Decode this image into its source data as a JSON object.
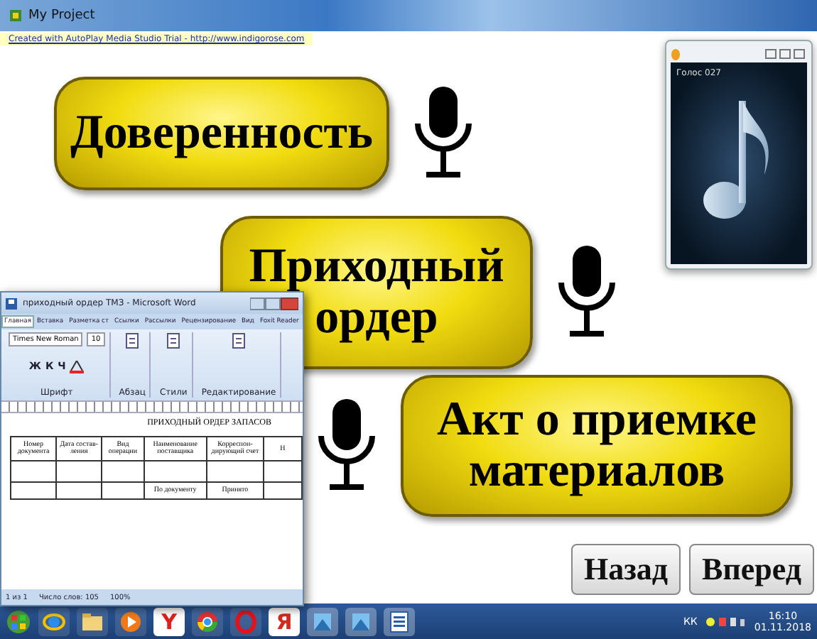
{
  "main_window": {
    "title": "My Project",
    "trial_link": "Created with AutoPlay Media Studio Trial - http://www.indigorose.com",
    "rows": [
      {
        "kind": "pill-then-mic",
        "label": "Доверенность"
      },
      {
        "kind": "pill-then-mic",
        "label": "Приходный ордер"
      },
      {
        "kind": "mic-then-pill",
        "label": "Акт о приемке материалов"
      }
    ],
    "nav": [
      "Назад",
      "Вперед"
    ]
  },
  "player": {
    "track": "Голос 027"
  },
  "word": {
    "title": "приходный ордер ТМЗ - Microsoft Word",
    "tabs": [
      {
        "label": "Главная",
        "selected": true
      },
      {
        "label": "Вставка",
        "selected": false
      },
      {
        "label": "Разметка ст",
        "selected": false
      },
      {
        "label": "Ссылки",
        "selected": false
      },
      {
        "label": "Рассылки",
        "selected": false
      },
      {
        "label": "Рецензирование",
        "selected": false
      },
      {
        "label": "Вид",
        "selected": false
      },
      {
        "label": "Foxit Reader",
        "selected": false
      }
    ],
    "font_name": "Times New Roman",
    "font_size": "10",
    "format_buttons": [
      "Ж",
      "К",
      "Ч"
    ],
    "groups": [
      "Шрифт",
      "Абзац",
      "Стили",
      "Редактирование"
    ],
    "heading": "ПРИХОДНЫЙ ОРДЕР ЗАПАСОВ",
    "columns": [
      {
        "label": "Номер документа"
      },
      {
        "label": "Дата состав-ления"
      },
      {
        "label": "Вид операции"
      },
      {
        "label": "Наименование поставщика",
        "sub": "По документу"
      },
      {
        "label": "Корреспон-дирующий счет",
        "sub": "Принято"
      },
      {
        "label": "Н"
      }
    ],
    "status": [
      "1 из 1",
      "Число слов: 105",
      "100%"
    ]
  },
  "taskbar": {
    "apps": [
      {
        "kind": "start"
      },
      {
        "kind": "ie"
      },
      {
        "kind": "folder"
      },
      {
        "kind": "player"
      },
      {
        "kind": "glyph",
        "glyph": "Y",
        "color": "#e0201c"
      },
      {
        "kind": "chrome"
      },
      {
        "kind": "opera"
      },
      {
        "kind": "glyph",
        "glyph": "Я",
        "color": "#d42a1e"
      },
      {
        "kind": "app"
      },
      {
        "kind": "app"
      },
      {
        "kind": "word"
      }
    ],
    "language": "КК",
    "time": "16:10",
    "date": "01.11.2018"
  }
}
